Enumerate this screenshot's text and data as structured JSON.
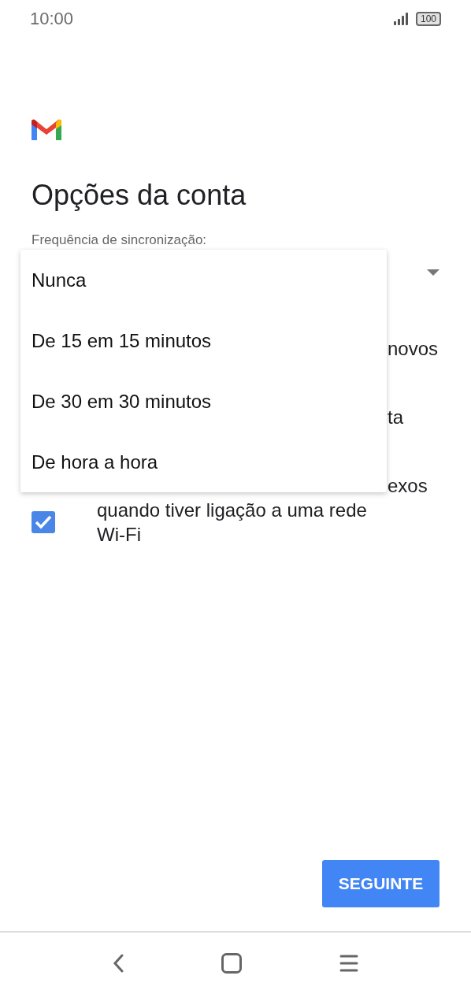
{
  "status_bar": {
    "time": "10:00",
    "battery": "100"
  },
  "title": "Opções da conta",
  "sync_field": {
    "label": "Frequência de sincronização:"
  },
  "options": [
    {
      "lines": [
        "novos"
      ]
    },
    {
      "lines": [
        "ta"
      ]
    },
    {
      "lines": [
        "exos",
        "quando tiver ligação a uma rede",
        "Wi-Fi"
      ],
      "checked": true
    }
  ],
  "menu": {
    "items": [
      "Nunca",
      "De 15 em 15 minutos",
      "De 30 em 30 minutos",
      "De hora a hora"
    ]
  },
  "next_button": "SEGUINTE"
}
